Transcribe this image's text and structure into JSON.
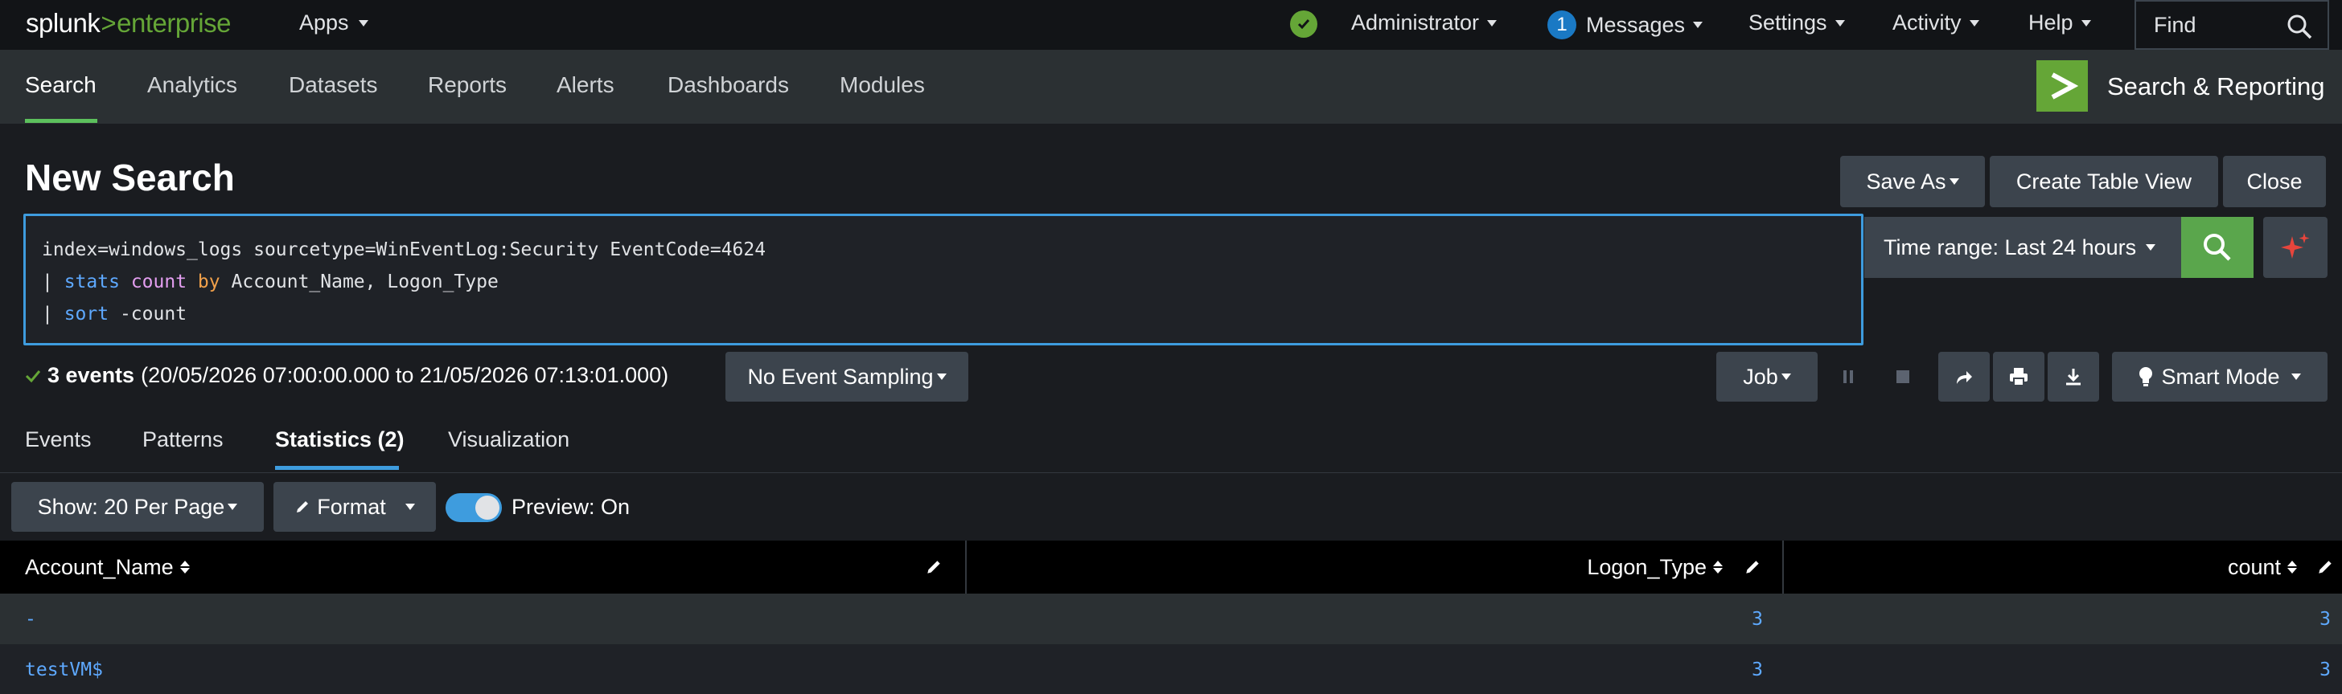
{
  "brand": {
    "name": "splunk",
    "separator": ">",
    "product": "enterprise",
    "accent": "#65a637"
  },
  "topbar": {
    "apps_label": "Apps",
    "status_icon": "check-circle-icon",
    "user_label": "Administrator",
    "messages_count": "1",
    "messages_label": "Messages",
    "settings_label": "Settings",
    "activity_label": "Activity",
    "help_label": "Help",
    "find_placeholder": "Find"
  },
  "nav": {
    "tabs": [
      {
        "label": "Search",
        "active": true
      },
      {
        "label": "Analytics"
      },
      {
        "label": "Datasets"
      },
      {
        "label": "Reports"
      },
      {
        "label": "Alerts"
      },
      {
        "label": "Dashboards"
      },
      {
        "label": "Modules"
      }
    ],
    "app_title": "Search & Reporting"
  },
  "page": {
    "title": "New Search",
    "buttons": {
      "save_as": "Save As",
      "create_table_view": "Create Table View",
      "close": "Close"
    }
  },
  "query": {
    "line1": "index=windows_logs sourcetype=WinEventLog:Security EventCode=4624",
    "line2": {
      "pipe": "| ",
      "cmd": "stats",
      "fn": "count",
      "by": "by",
      "rest": "Account_Name, Logon_Type"
    },
    "line3": {
      "pipe": "| ",
      "cmd": "sort",
      "rest": "-count"
    }
  },
  "time_range": {
    "label": "Time range: Last 24 hours"
  },
  "status": {
    "events": "3 events",
    "range": "(20/05/2026 07:00:00.000 to 21/05/2026 07:13:01.000)",
    "sampling": "No Event Sampling",
    "job": "Job",
    "mode": "Smart Mode"
  },
  "subtabs": [
    {
      "label": "Events"
    },
    {
      "label": "Patterns"
    },
    {
      "label": "Statistics (2)",
      "active": true
    },
    {
      "label": "Visualization"
    }
  ],
  "table_controls": {
    "show": "Show: 20 Per Page",
    "format": "Format",
    "preview": "Preview: On"
  },
  "table": {
    "columns": [
      "Account_Name",
      "Logon_Type",
      "count"
    ],
    "rows": [
      [
        "-",
        "3",
        "3"
      ],
      [
        "testVM$",
        "3",
        "3"
      ]
    ]
  }
}
